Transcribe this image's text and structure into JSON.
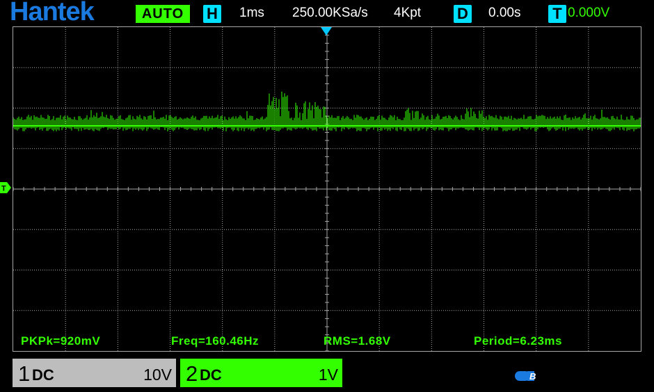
{
  "header": {
    "brand": "Hantek",
    "mode": "AUTO",
    "horizontal_tag": "H",
    "timebase": "1ms",
    "sample_rate": "250.00KSa/s",
    "memory_depth": "4Kpt",
    "delay_tag": "D",
    "delay": "0.00s",
    "trigger_tag": "T",
    "trigger_level": "0.000V"
  },
  "markers": {
    "trigger_position_icon": "down-triangle-icon",
    "ch1_level_label": "T"
  },
  "measurements": {
    "pkpk": "PKPk=920mV",
    "freq": "Freq=160.46Hz",
    "rms": "RMS=1.68V",
    "period": "Period=6.23ms"
  },
  "channels": [
    {
      "number": "1",
      "coupling": "DC",
      "scale": "10V",
      "color": "#bdbdbd"
    },
    {
      "number": "2",
      "coupling": "DC",
      "scale": "1V",
      "color": "#33ff00"
    }
  ],
  "status_icons": {
    "usb": "usb-icon",
    "usb_label": "B"
  },
  "colors": {
    "brand": "#1a7ae0",
    "trace": "#33ff00",
    "tag": "#00e0ff",
    "grid": "#a8a8a8"
  }
}
